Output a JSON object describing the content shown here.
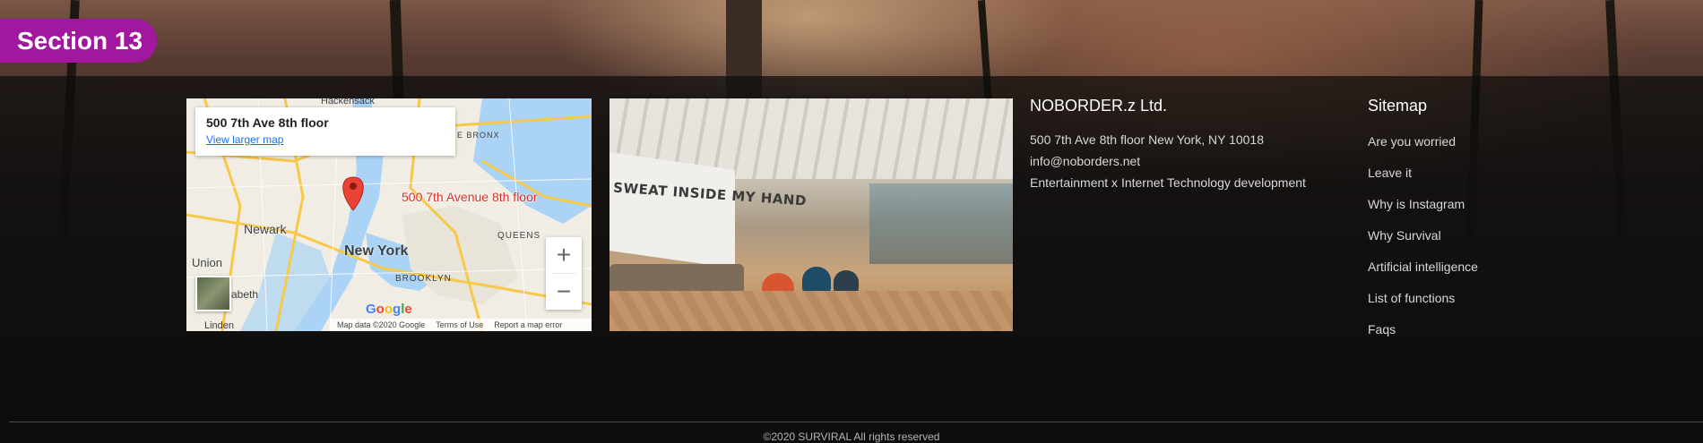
{
  "section_badge": "Section 13",
  "map": {
    "address_title": "500 7th Ave 8th floor",
    "view_larger": "View larger map",
    "pin_label": "500 7th Avenue 8th floor",
    "labels": {
      "new_york": "New York",
      "newark": "Newark",
      "union": "Union",
      "queens": "QUEENS",
      "brooklyn": "BROOKLYN",
      "hackensack": "Hackensack",
      "bronx": "E BRONX",
      "elizabeth": "zabeth",
      "linden": "Linden"
    },
    "zoom_in": "+",
    "zoom_out": "−",
    "attribution": {
      "data": "Map data ©2020 Google",
      "terms": "Terms of Use",
      "report": "Report a map error"
    }
  },
  "photo": {
    "wall_text": "SWEAT INSIDE MY HAND"
  },
  "company": {
    "name": "NOBORDER.z Ltd.",
    "address": "500 7th Ave 8th floor New York, NY 10018",
    "email": "info@noborders.net",
    "tagline": "Entertainment x Internet Technology development"
  },
  "sitemap": {
    "title": "Sitemap",
    "items": [
      "Are you worried",
      "Leave it",
      "Why is Instagram",
      "Why Survival",
      "Artificial intelligence",
      "List of functions",
      "Faqs"
    ]
  },
  "copyright": "©2020 SURVIRAL All rights reserved",
  "colors": {
    "badge": "#a117a0",
    "map_pin": "#d93025",
    "link_blue": "#1a73e8"
  }
}
